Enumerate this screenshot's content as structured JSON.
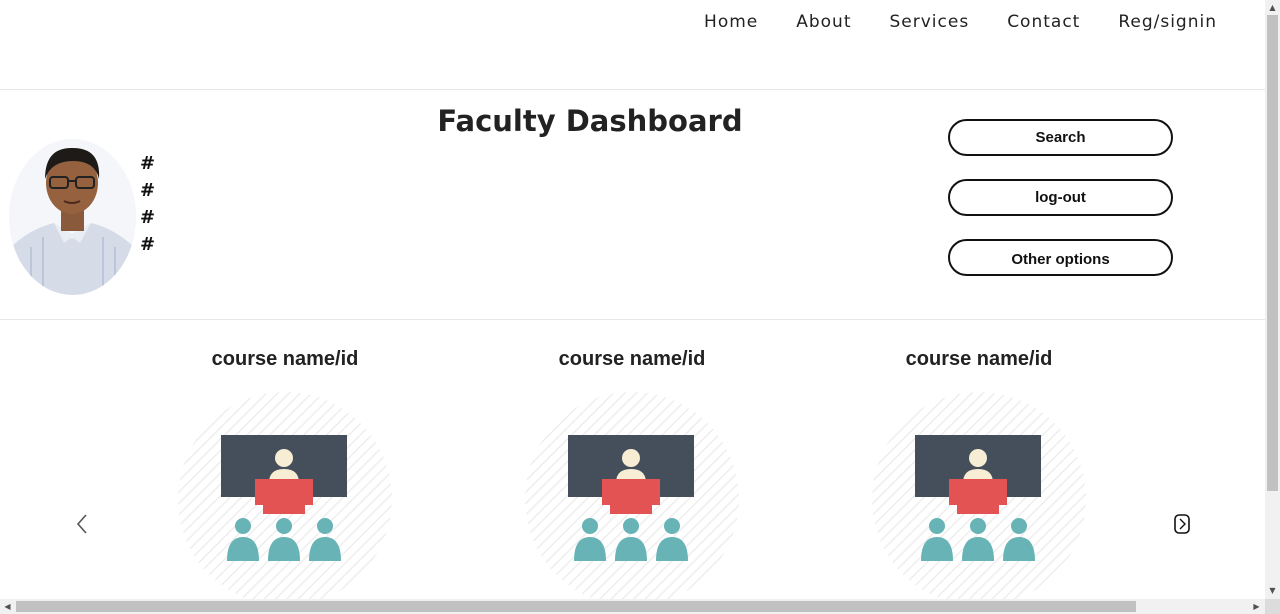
{
  "nav": {
    "items": [
      {
        "label": "Home"
      },
      {
        "label": "About"
      },
      {
        "label": "Services"
      },
      {
        "label": "Contact"
      },
      {
        "label": "Reg/signin"
      }
    ]
  },
  "header": {
    "title": "Faculty Dashboard",
    "info_items": [
      "#",
      "#",
      "#",
      "#"
    ],
    "buttons": {
      "search": "Search",
      "logout": "log-out",
      "other": "Other options"
    }
  },
  "courses": [
    {
      "title": "course name/id"
    },
    {
      "title": "course name/id"
    },
    {
      "title": "course name/id"
    }
  ],
  "icons": {
    "prev": "chevron-left-icon",
    "next": "chevron-right-icon",
    "course": "classroom-icon"
  },
  "colors": {
    "board": "#454f5b",
    "desk": "#e35353",
    "students": "#67b3b5",
    "teacher_head": "#f6edd4"
  }
}
